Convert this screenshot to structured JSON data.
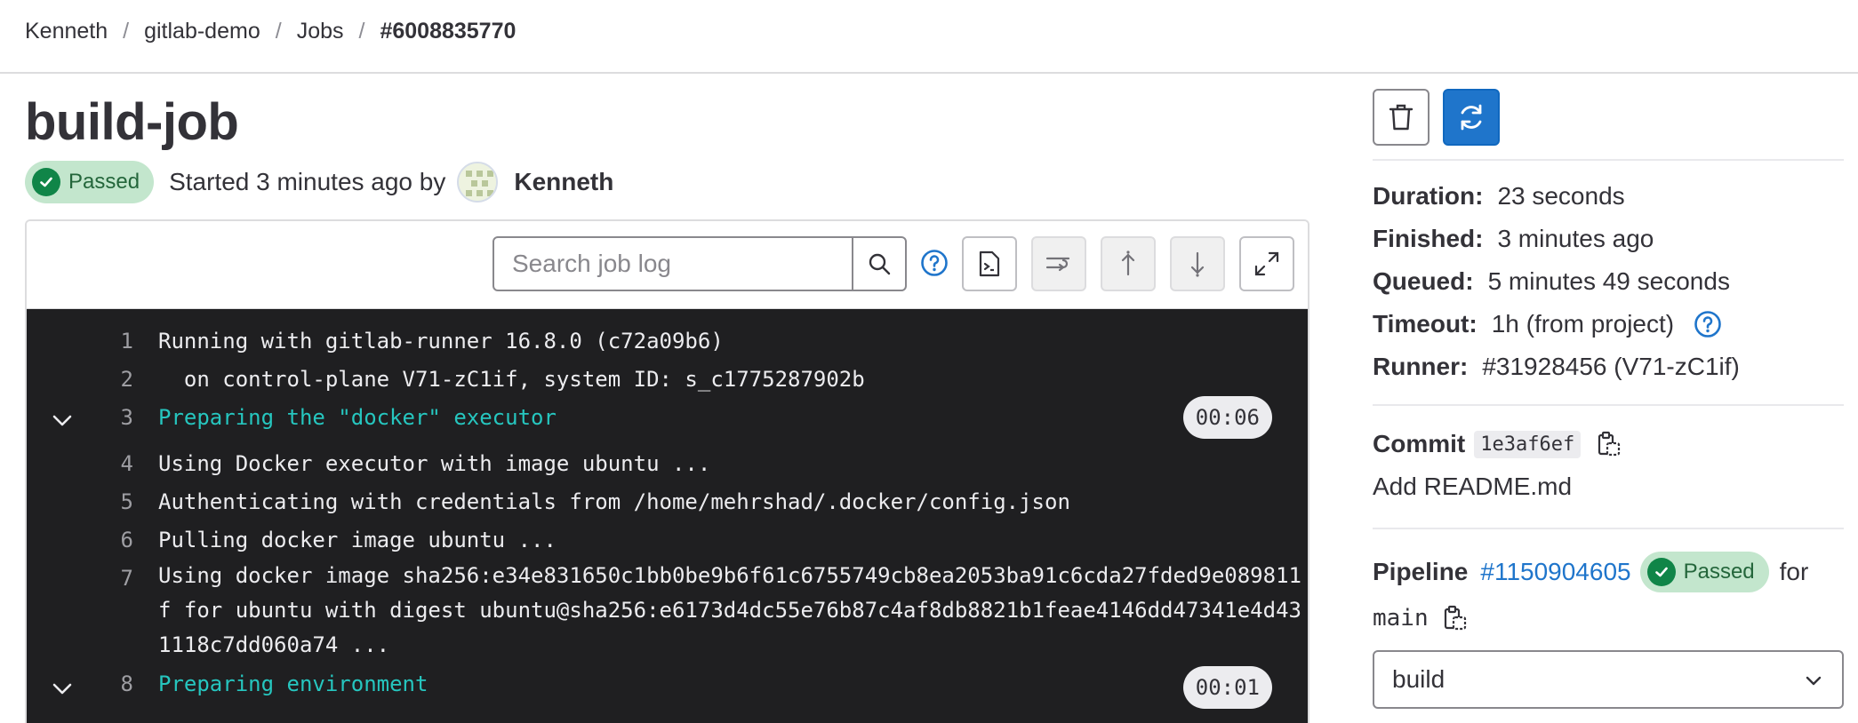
{
  "breadcrumb": {
    "items": [
      "Kenneth",
      "gitlab-demo",
      "Jobs",
      "#6008835770"
    ]
  },
  "job": {
    "title": "build-job",
    "status": "Passed",
    "started_text": "Started 3 minutes ago by",
    "author": "Kenneth"
  },
  "toolbar": {
    "search_placeholder": "Search job log"
  },
  "log": {
    "lines": [
      {
        "num": "1",
        "text": "Running with gitlab-runner 16.8.0 (c72a09b6)"
      },
      {
        "num": "2",
        "text": "  on control-plane V71-zC1if, system ID: s_c1775287902b"
      },
      {
        "num": "3",
        "text": "Preparing the \"docker\" executor",
        "duration": "00:06"
      },
      {
        "num": "4",
        "text": "Using Docker executor with image ubuntu ..."
      },
      {
        "num": "5",
        "text": "Authenticating with credentials from /home/mehrshad/.docker/config.json"
      },
      {
        "num": "6",
        "text": "Pulling docker image ubuntu ..."
      },
      {
        "num": "7",
        "text": "Using docker image sha256:e34e831650c1bb0be9b6f61c6755749cb8ea2053ba91c6cda27fded9e089811f for ubuntu with digest ubuntu@sha256:e6173d4dc55e76b87c4af8db8821b1feae4146dd47341e4d431118c7dd060a74 ..."
      },
      {
        "num": "8",
        "text": "Preparing environment",
        "duration": "00:01"
      }
    ]
  },
  "sidebar": {
    "duration_label": "Duration:",
    "duration_value": "23 seconds",
    "finished_label": "Finished:",
    "finished_value": "3 minutes ago",
    "queued_label": "Queued:",
    "queued_value": "5 minutes 49 seconds",
    "timeout_label": "Timeout:",
    "timeout_value": "1h (from project)",
    "runner_label": "Runner:",
    "runner_value": "#31928456 (V71-zC1if)",
    "commit_label": "Commit",
    "commit_sha": "1e3af6ef",
    "commit_message": "Add README.md",
    "pipeline_label": "Pipeline",
    "pipeline_id": "#1150904605",
    "pipeline_status": "Passed",
    "for_text": "for",
    "branch": "main",
    "stage": "build"
  },
  "colors": {
    "accent": "#1f75cb",
    "success": "#108548",
    "log_background": "#1f1f21",
    "section_text": "#26c6bf"
  }
}
